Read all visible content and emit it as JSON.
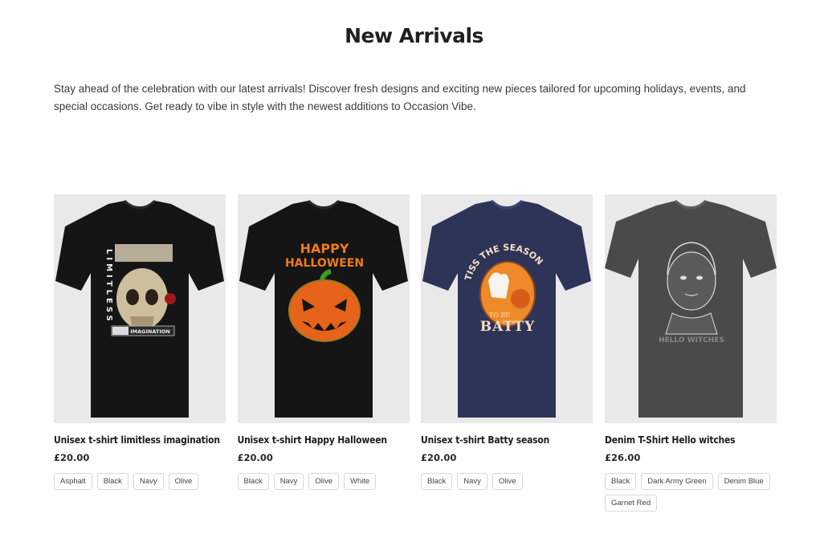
{
  "section": {
    "title": "New Arrivals",
    "description": "Stay ahead of the celebration with our latest arrivals! Discover fresh designs and exciting new pieces tailored for upcoming holidays, events, and special occasions. Get ready to vibe in style with the newest additions to Occasion Vibe."
  },
  "products": [
    {
      "name": "Unisex t-shirt limitless imagination",
      "price": "£20.00",
      "shirt_color": "#151515",
      "print_text": [
        "LIMITLESS",
        "IMAGINATION"
      ],
      "colors": [
        "Asphalt",
        "Black",
        "Navy",
        "Olive"
      ]
    },
    {
      "name": "Unisex t-shirt Happy Halloween",
      "price": "£20.00",
      "shirt_color": "#151515",
      "print_text": [
        "HAPPY",
        "HALLOWEEN"
      ],
      "colors": [
        "Black",
        "Navy",
        "Olive",
        "White"
      ]
    },
    {
      "name": "Unisex t-shirt Batty season",
      "price": "£20.00",
      "shirt_color": "#2e3458",
      "print_text": [
        "TISS THE SEASON",
        "TO BE",
        "BATTY"
      ],
      "colors": [
        "Black",
        "Navy",
        "Olive"
      ]
    },
    {
      "name": "Denim T-Shirt Hello witches",
      "price": "£26.00",
      "shirt_color": "#4a4a4a",
      "print_text": [
        "HELLO WITCHES"
      ],
      "colors": [
        "Black",
        "Dark Army Green",
        "Denim Blue",
        "Garnet Red"
      ]
    }
  ]
}
